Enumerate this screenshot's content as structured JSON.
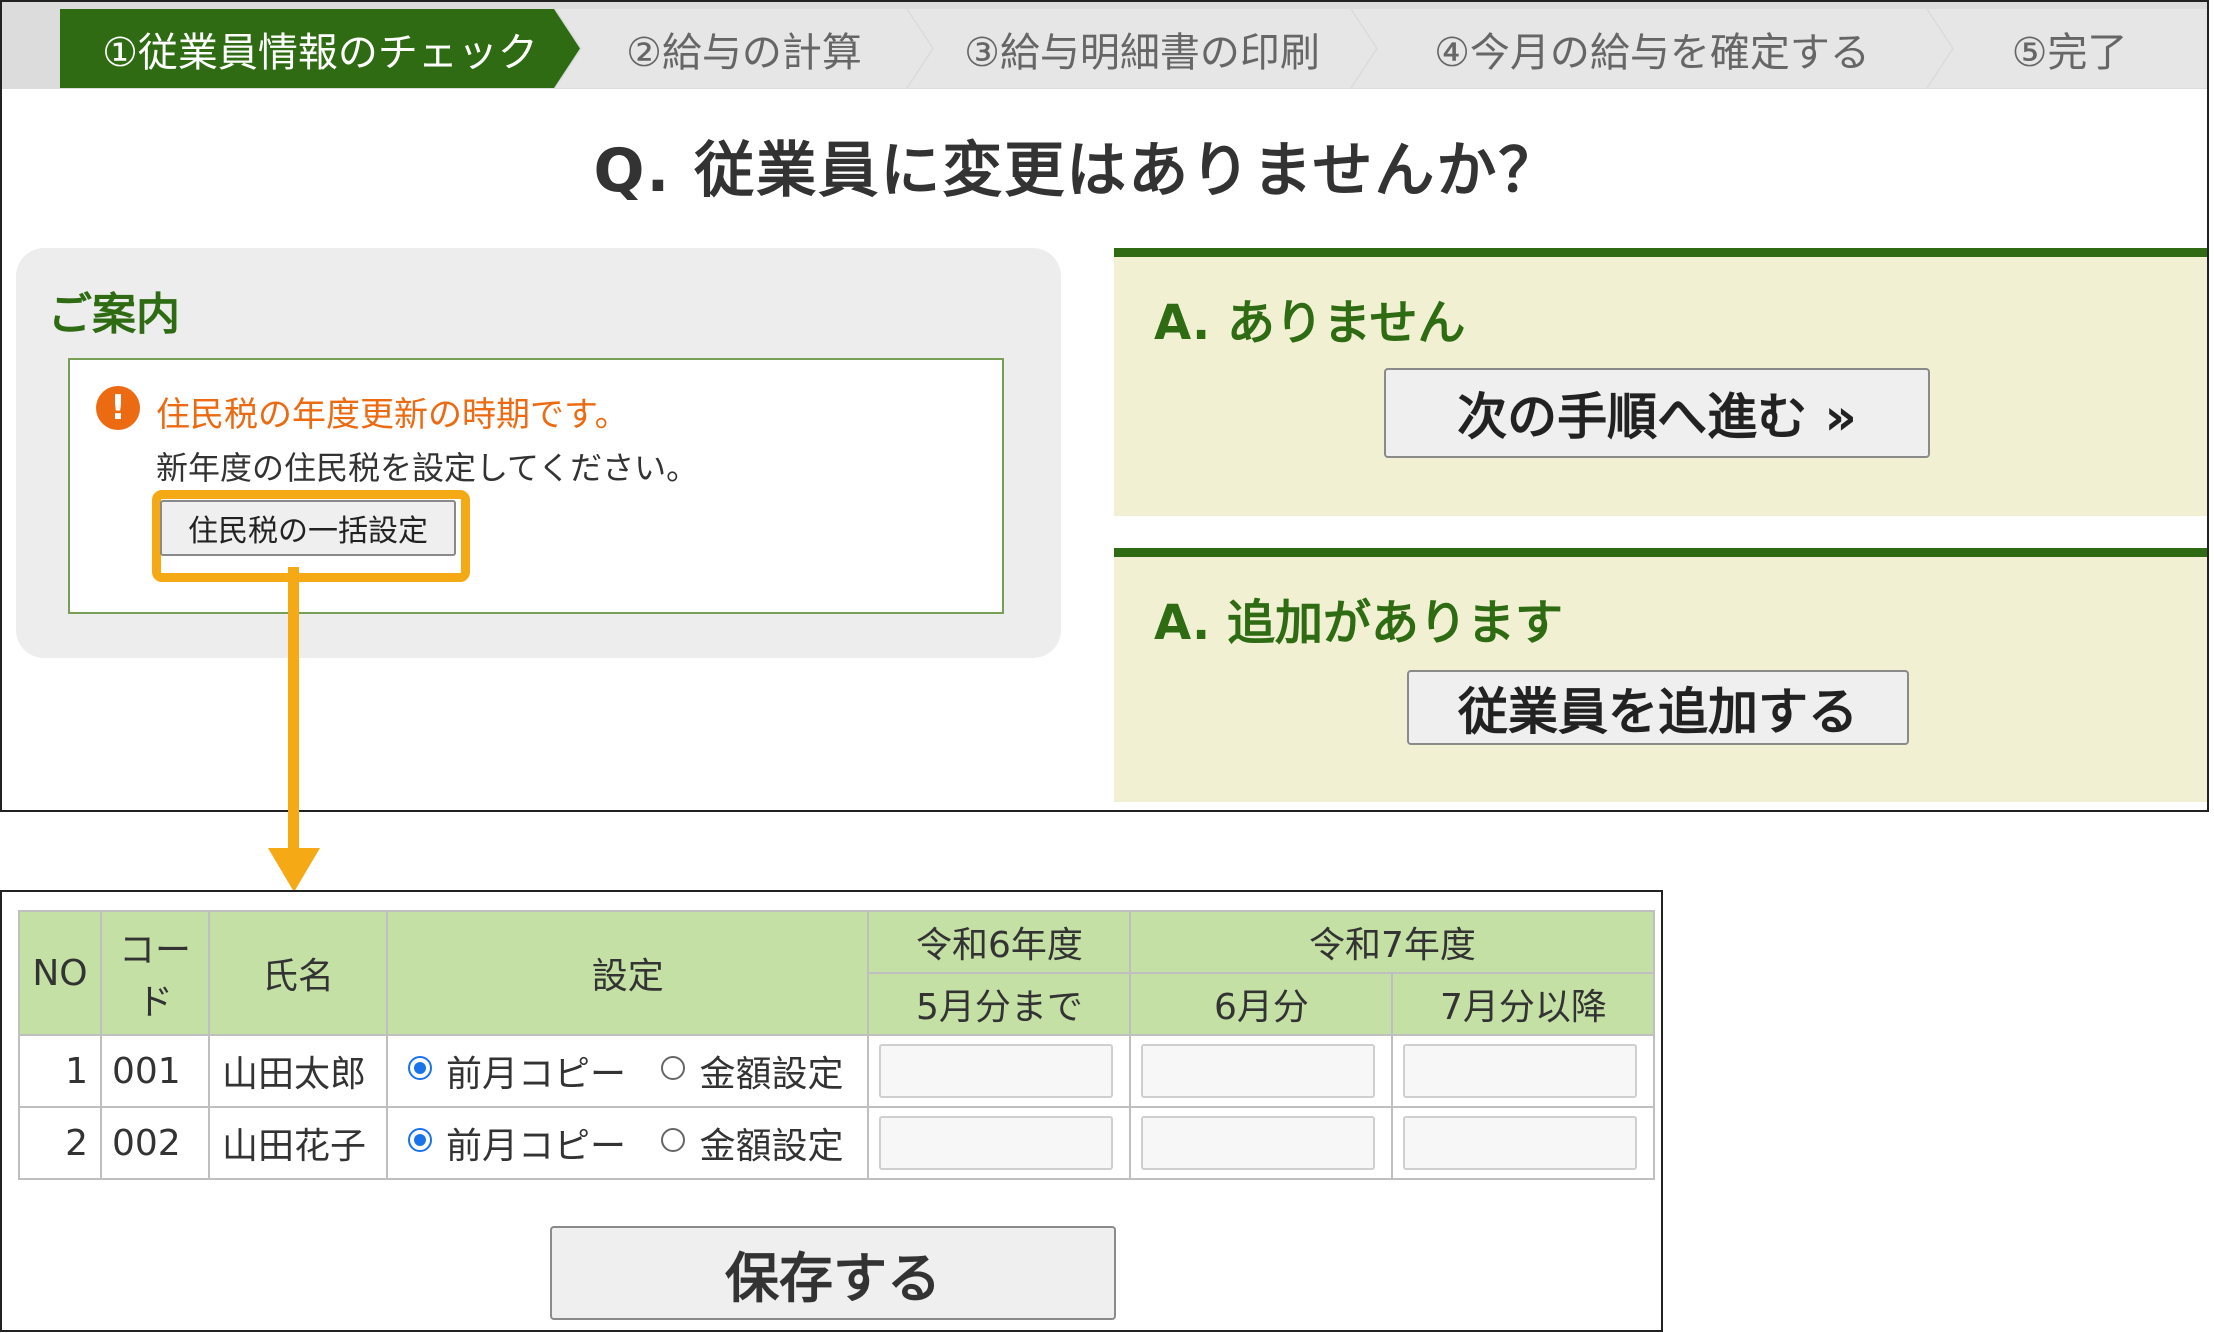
{
  "steps": [
    {
      "label": "①従業員情報のチェック",
      "active": true
    },
    {
      "label": "②給与の計算"
    },
    {
      "label": "③給与明細書の印刷"
    },
    {
      "label": "④今月の給与を確定する"
    },
    {
      "label": "⑤完了"
    }
  ],
  "question": "Q. 従業員に変更はありませんか？",
  "guide": {
    "title": "ご案内",
    "alert_icon": "exclamation-circle-icon",
    "notice_title": "住民税の年度更新の時期です。",
    "notice_body": "新年度の住民税を設定してください。",
    "bulk_button": "住民税の一括設定"
  },
  "answers": {
    "none": {
      "title": "A. ありません",
      "button": "次の手順へ進む »"
    },
    "add": {
      "title": "A. 追加があります",
      "button": "従業員を追加する"
    }
  },
  "colors": {
    "accent_green": "#2e6b12",
    "highlight": "#f5a915",
    "alert": "#ec6b12",
    "header_bg": "#c4e0a5"
  },
  "table": {
    "headers": {
      "no": "NO",
      "code": "コード",
      "name": "氏名",
      "setting": "設定",
      "r6": "令和6年度",
      "r7": "令和7年度",
      "until_may": "5月分まで",
      "june": "6月分",
      "july_on": "7月分以降"
    },
    "option_copy": "前月コピー",
    "option_amount": "金額設定",
    "rows": [
      {
        "no": "1",
        "code": "001",
        "name": "山田太郎",
        "selected": "前月コピー",
        "until_may": "",
        "june": "",
        "july_on": ""
      },
      {
        "no": "2",
        "code": "002",
        "name": "山田花子",
        "selected": "前月コピー",
        "until_may": "",
        "june": "",
        "july_on": ""
      }
    ]
  },
  "save_button": "保存する"
}
